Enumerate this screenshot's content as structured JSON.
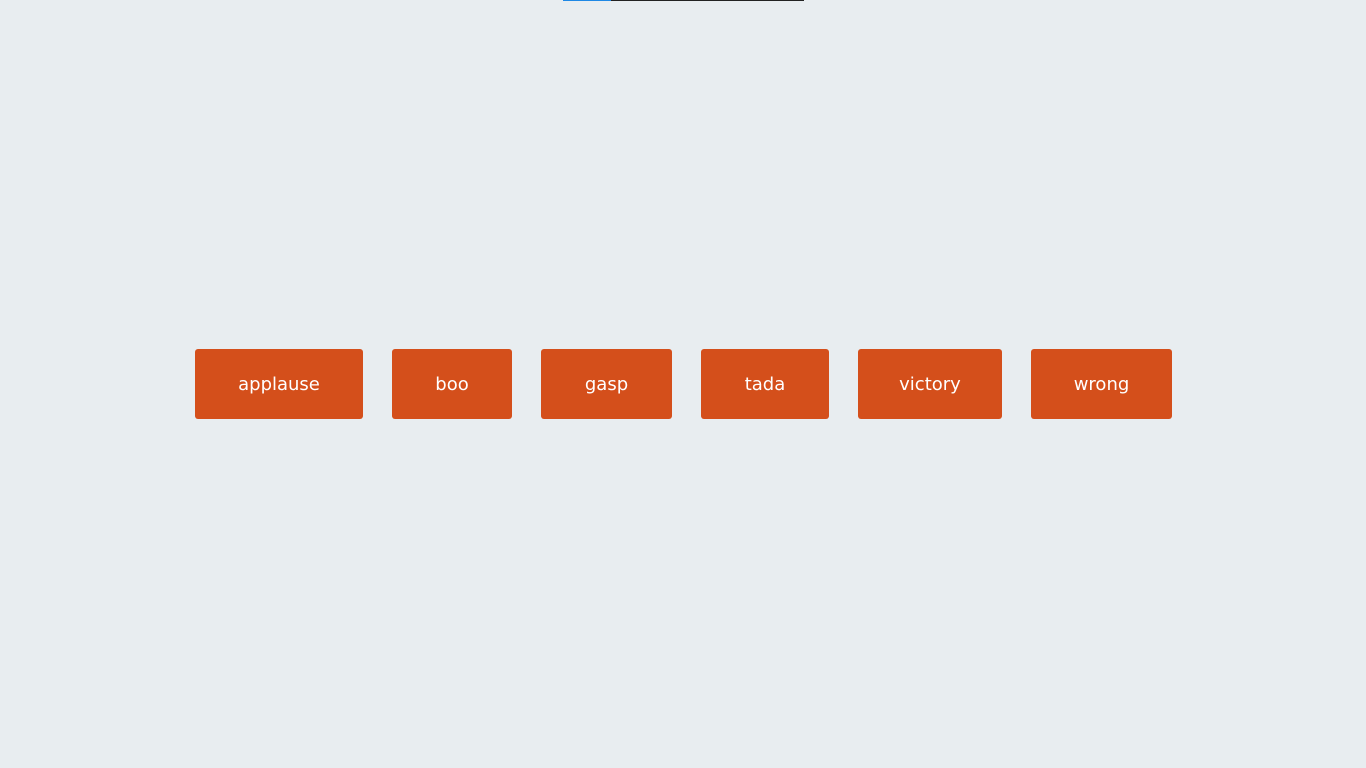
{
  "progress": {
    "fraction": 0.2,
    "track_color": "#222222",
    "fill_color": "#1e88e5"
  },
  "buttons": [
    {
      "label": "applause"
    },
    {
      "label": "boo"
    },
    {
      "label": "gasp"
    },
    {
      "label": "tada"
    },
    {
      "label": "victory"
    },
    {
      "label": "wrong"
    }
  ],
  "colors": {
    "background": "#e8edf0",
    "button": "#d44f1b",
    "button_text": "#ffffff"
  }
}
